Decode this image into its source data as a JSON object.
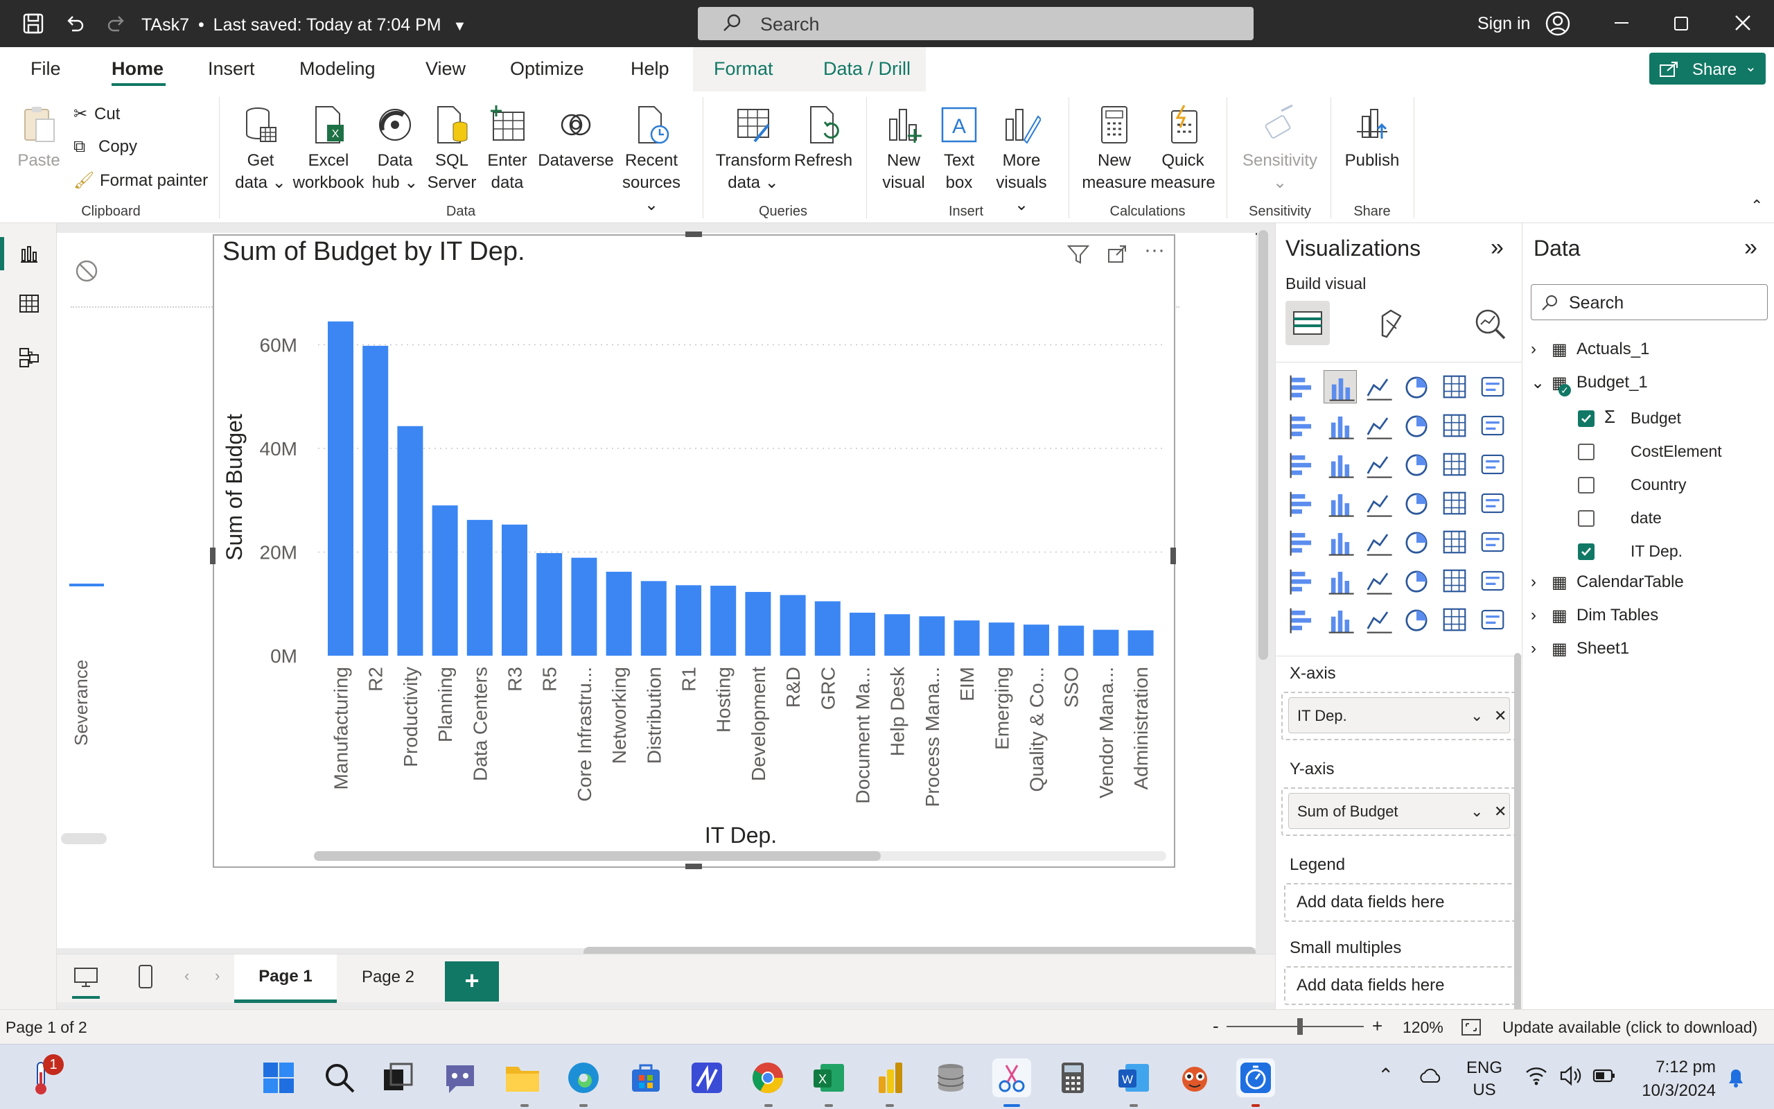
{
  "titlebar": {
    "file_title": "TAsk7",
    "save_status": "Last saved: Today at 7:04 PM",
    "search_placeholder": "Search",
    "signin": "Sign in"
  },
  "menu": {
    "file": "File",
    "home": "Home",
    "insert": "Insert",
    "modeling": "Modeling",
    "view": "View",
    "optimize": "Optimize",
    "help": "Help",
    "format": "Format",
    "data_drill": "Data / Drill",
    "share": "Share"
  },
  "ribbon": {
    "clipboard": {
      "paste": "Paste",
      "cut": "Cut",
      "copy": "Copy",
      "format_painter": "Format painter",
      "group": "Clipboard"
    },
    "data": {
      "get_data_1": "Get",
      "get_data_2": "data",
      "excel_1": "Excel",
      "excel_2": "workbook",
      "hub_1": "Data",
      "hub_2": "hub",
      "sql_1": "SQL",
      "sql_2": "Server",
      "enter_1": "Enter",
      "enter_2": "data",
      "dataverse": "Dataverse",
      "recent_1": "Recent",
      "recent_2": "sources",
      "group": "Data"
    },
    "queries": {
      "transform_1": "Transform",
      "transform_2": "data",
      "refresh": "Refresh",
      "group": "Queries"
    },
    "insert": {
      "new_visual_1": "New",
      "new_visual_2": "visual",
      "text_box_1": "Text",
      "text_box_2": "box",
      "more_visuals_1": "More",
      "more_visuals_2": "visuals",
      "group": "Insert"
    },
    "calculations": {
      "new_measure_1": "New",
      "new_measure_2": "measure",
      "quick_measure_1": "Quick",
      "quick_measure_2": "measure",
      "group": "Calculations"
    },
    "sensitivity": {
      "label": "Sensitivity",
      "group": "Sensitivity"
    },
    "share": {
      "publish": "Publish",
      "group": "Share"
    }
  },
  "canvas": {
    "side_label": "Severance"
  },
  "chart_data": {
    "type": "bar",
    "title": "Sum of Budget by IT Dep.",
    "xlabel": "IT Dep.",
    "ylabel": "Sum of Budget",
    "ylim": [
      0,
      65000000
    ],
    "yticks": [
      "0M",
      "20M",
      "40M",
      "60M"
    ],
    "ytick_values": [
      0,
      20000000,
      40000000,
      60000000
    ],
    "color": "#3b86f3",
    "categories": [
      "Manufacturing",
      "R2",
      "Productivity",
      "Planning",
      "Data Centers",
      "R3",
      "R5",
      "Core Infrastru...",
      "Networking",
      "Distribution",
      "R1",
      "Hosting",
      "Development",
      "R&D",
      "GRC",
      "Document Ma...",
      "Help Desk",
      "Process Mana...",
      "EIM",
      "Emerging",
      "Quality & Co...",
      "SSO",
      "Vendor Mana...",
      "Administration"
    ],
    "values": [
      64500000,
      59800000,
      44300000,
      29000000,
      26200000,
      25300000,
      19800000,
      18900000,
      16200000,
      14400000,
      13600000,
      13500000,
      12300000,
      11700000,
      10500000,
      8300000,
      8000000,
      7600000,
      6800000,
      6400000,
      6000000,
      5800000,
      5000000,
      4900000
    ]
  },
  "visualizations": {
    "title": "Visualizations",
    "build_visual": "Build visual",
    "xaxis_label": "X-axis",
    "xaxis_field": "IT Dep.",
    "yaxis_label": "Y-axis",
    "yaxis_field": "Sum of Budget",
    "legend_label": "Legend",
    "legend_placeholder": "Add data fields here",
    "small_multiples_label": "Small multiples",
    "small_multiples_placeholder": "Add data fields here"
  },
  "data_pane": {
    "title": "Data",
    "search_placeholder": "Search",
    "tables": {
      "actuals": "Actuals_1",
      "budget": "Budget_1",
      "calendar": "CalendarTable",
      "dim": "Dim Tables",
      "sheet": "Sheet1"
    },
    "fields": [
      {
        "name": "Budget",
        "checked": true
      },
      {
        "name": "CostElement",
        "checked": false
      },
      {
        "name": "Country",
        "checked": false
      },
      {
        "name": "date",
        "checked": false
      },
      {
        "name": "IT Dep.",
        "checked": true
      }
    ]
  },
  "pages": {
    "page1": "Page 1",
    "page2": "Page 2",
    "add": "+"
  },
  "status": {
    "page_info": "Page 1 of 2",
    "zoom": "120%",
    "update": "Update available (click to download)"
  },
  "taskbar": {
    "notification_count": "1",
    "lang_1": "ENG",
    "lang_2": "US",
    "time": "7:12 pm",
    "date": "10/3/2024"
  }
}
